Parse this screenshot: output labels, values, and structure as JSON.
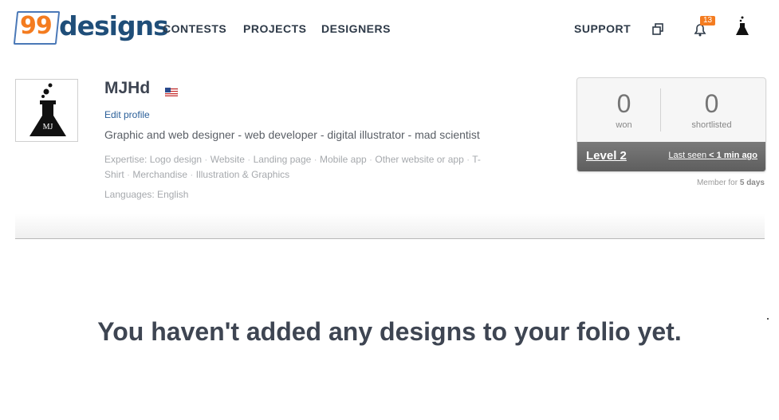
{
  "header": {
    "logo": {
      "number": "99",
      "word": "designs"
    },
    "nav": [
      {
        "label": "CONTESTS"
      },
      {
        "label": "PROJECTS"
      },
      {
        "label": "DESIGNERS"
      }
    ],
    "support_label": "SUPPORT",
    "notifications_count": "13",
    "icons": [
      "windows-icon",
      "bell-icon",
      "flask-avatar-icon"
    ]
  },
  "profile": {
    "name": "MJHd",
    "edit_label": "Edit profile",
    "tagline": "Graphic and web designer - web developer - digital illustrator - mad scientist",
    "expertise_label": "Expertise:",
    "expertise": [
      "Logo design",
      "Website",
      "Landing page",
      "Mobile app",
      "Other website or app",
      "T-Shirt",
      "Merchandise",
      "Illustration & Graphics"
    ],
    "languages": "Languages: English"
  },
  "stats": {
    "won_value": "0",
    "won_label": "won",
    "shortlisted_value": "0",
    "shortlisted_label": "shortlisted",
    "level": "Level 2",
    "last_seen_prefix": "Last seen",
    "last_seen_value": "< 1 min ago",
    "member_prefix": "Member for",
    "member_value": "5 days"
  },
  "empty_message": "You haven't added any designs to your folio yet.",
  "colors": {
    "brand_orange": "#f47c20",
    "brand_blue": "#1f4e79",
    "text_dark": "#3e4552"
  }
}
